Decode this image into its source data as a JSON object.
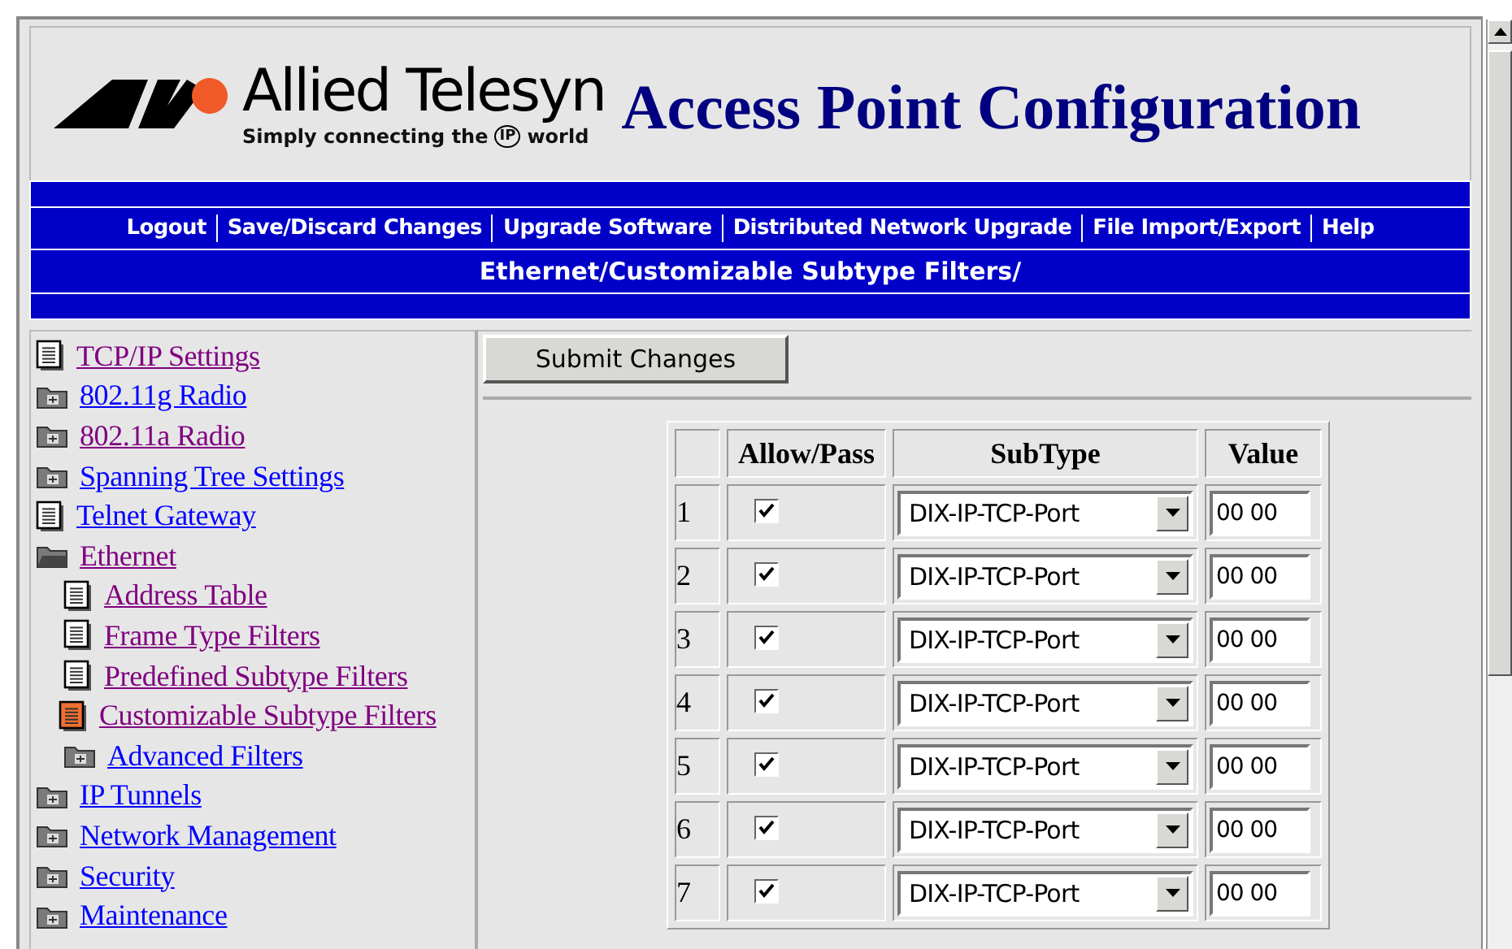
{
  "header": {
    "brand": "Allied Telesyn",
    "tagline": "Simply connecting the",
    "tagline_badge": "IP",
    "tagline_end": "world",
    "title": "Access Point Configuration"
  },
  "nav": [
    {
      "label": "Logout"
    },
    {
      "label": "Save/Discard Changes"
    },
    {
      "label": "Upgrade Software"
    },
    {
      "label": "Distributed Network Upgrade"
    },
    {
      "label": "File Import/Export"
    },
    {
      "label": "Help"
    }
  ],
  "breadcrumb": "Ethernet/Customizable Subtype Filters/",
  "sidebar": {
    "items": [
      {
        "label": "TCP/IP Settings",
        "kind": "page",
        "visited": true,
        "selected": false
      },
      {
        "label": "802.11g Radio",
        "kind": "folder",
        "visited": false,
        "selected": false
      },
      {
        "label": "802.11a Radio",
        "kind": "folder",
        "visited": true,
        "selected": false
      },
      {
        "label": "Spanning Tree Settings",
        "kind": "folder",
        "visited": false,
        "selected": false
      },
      {
        "label": "Telnet Gateway",
        "kind": "page",
        "visited": false,
        "selected": false
      },
      {
        "label": "Ethernet",
        "kind": "folder",
        "visited": true,
        "selected": false,
        "expanded": true,
        "children": [
          {
            "label": "Address Table",
            "kind": "page",
            "visited": true,
            "selected": false
          },
          {
            "label": "Frame Type Filters",
            "kind": "page",
            "visited": true,
            "selected": false
          },
          {
            "label": "Predefined Subtype Filters",
            "kind": "page",
            "visited": true,
            "selected": false
          },
          {
            "label": "Customizable Subtype Filters",
            "kind": "page",
            "visited": true,
            "selected": true
          },
          {
            "label": "Advanced Filters",
            "kind": "folder",
            "visited": false,
            "selected": false
          }
        ]
      },
      {
        "label": "IP Tunnels",
        "kind": "folder",
        "visited": false,
        "selected": false
      },
      {
        "label": "Network Management",
        "kind": "folder",
        "visited": false,
        "selected": false
      },
      {
        "label": "Security",
        "kind": "folder",
        "visited": false,
        "selected": false
      },
      {
        "label": "Maintenance",
        "kind": "folder",
        "visited": false,
        "selected": false
      }
    ]
  },
  "submit_button": "Submit Changes",
  "table": {
    "columns": [
      "Allow/Pass",
      "SubType",
      "Value"
    ],
    "rows": [
      {
        "index": "1",
        "checked": true,
        "subtype": "DIX-IP-TCP-Port",
        "value": "00 00"
      },
      {
        "index": "2",
        "checked": true,
        "subtype": "DIX-IP-TCP-Port",
        "value": "00 00"
      },
      {
        "index": "3",
        "checked": true,
        "subtype": "DIX-IP-TCP-Port",
        "value": "00 00"
      },
      {
        "index": "4",
        "checked": true,
        "subtype": "DIX-IP-TCP-Port",
        "value": "00 00"
      },
      {
        "index": "5",
        "checked": true,
        "subtype": "DIX-IP-TCP-Port",
        "value": "00 00"
      },
      {
        "index": "6",
        "checked": true,
        "subtype": "DIX-IP-TCP-Port",
        "value": "00 00"
      },
      {
        "index": "7",
        "checked": true,
        "subtype": "DIX-IP-TCP-Port",
        "value": "00 00"
      }
    ]
  }
}
